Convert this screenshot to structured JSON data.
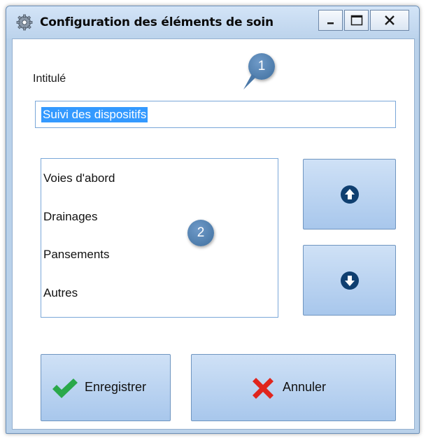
{
  "window": {
    "title": "Configuration des éléments de soin",
    "icon": "gear-icon",
    "controls": [
      "minimize-icon",
      "maximize-icon",
      "close-icon"
    ]
  },
  "form": {
    "label": "Intitulé",
    "input_value": "Suivi des dispositifs"
  },
  "list": {
    "items": [
      "Voies d'abord",
      "Drainages",
      "Pansements",
      "Autres"
    ]
  },
  "reorder": {
    "up_icon": "arrow-up-circle-icon",
    "down_icon": "arrow-down-circle-icon"
  },
  "buttons": {
    "save_label": "Enregistrer",
    "cancel_label": "Annuler",
    "save_icon": "check-icon",
    "cancel_icon": "cross-icon"
  },
  "callouts": [
    "1",
    "2"
  ],
  "colors": {
    "selection": "#3399ff",
    "button_gradient_top": "#cfe1f6",
    "button_gradient_bottom": "#a8c7ec",
    "callout": "#4f7eae",
    "check": "#2aa84a",
    "cross": "#e0251d"
  }
}
